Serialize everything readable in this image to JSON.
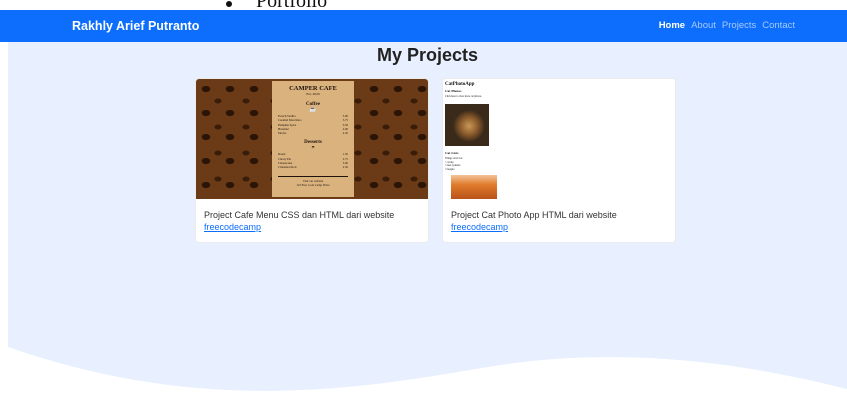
{
  "fragment": {
    "text": "Portfolio"
  },
  "navbar": {
    "brand": "Rakhly Arief Putranto",
    "links": [
      "Home",
      "About",
      "Projects",
      "Contact"
    ],
    "active": "Home",
    "color": "#0d6efd"
  },
  "main": {
    "title": "My Projects",
    "background": "#e8f0ff",
    "cards": [
      {
        "description": "Project Cafe Menu CSS dan HTML dari website",
        "link_text": "freecodecamp",
        "thumb": {
          "title": "CAMPER CAFE",
          "subtitle": "Est. 2020",
          "section1": "Coffee",
          "coffee_items": [
            [
              "French Vanilla",
              "3.00"
            ],
            [
              "Caramel Macchiato",
              "3.75"
            ],
            [
              "Pumpkin Spice",
              "3.50"
            ],
            [
              "Hazelnut",
              "4.00"
            ],
            [
              "Mocha",
              "4.50"
            ]
          ],
          "section2": "Desserts",
          "dessert_items": [
            [
              "Donut",
              "1.50"
            ],
            [
              "Cherry Pie",
              "2.75"
            ],
            [
              "Cheesecake",
              "3.00"
            ],
            [
              "Cinnamon Roll",
              "2.50"
            ]
          ],
          "footer1": "Visit our website",
          "footer2": "123 Free Code Camp Drive"
        }
      },
      {
        "description": "Project Cat Photo App HTML dari website",
        "link_text": "freecodecamp",
        "thumb": {
          "title": "CatPhotoApp",
          "heading1": "Cat Photos",
          "text1": "Click here to view more cat photos.",
          "heading2": "Cat Lists",
          "text2": "Things cats love:",
          "list": [
            "cat nip",
            "laser pointers",
            "lasagna"
          ]
        }
      }
    ]
  }
}
